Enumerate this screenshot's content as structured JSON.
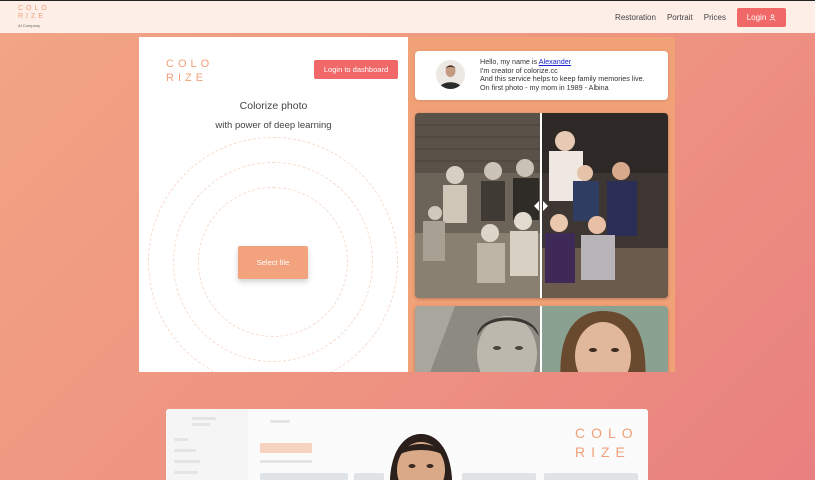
{
  "nav": {
    "logo_line1": "COLO",
    "logo_line2": "RIZE",
    "logo_sub": "AI Company",
    "links": [
      "Restoration",
      "Portrait",
      "Prices"
    ],
    "login_label": "Login"
  },
  "hero": {
    "logo_line1": "COLO",
    "logo_line2": "RIZE",
    "dashboard_button": "Login to dashboard",
    "tagline_1": "Colorize photo",
    "tagline_2": "with power of deep learning",
    "select_button": "Select file"
  },
  "intro": {
    "greeting": "Hello, my name is ",
    "name_link": "Alexander",
    "line2": "I'm creator of colorize.cc",
    "line3": "And this service helps to keep family memories live.",
    "line4": "On first photo - my mom in 1989 -  Albina"
  },
  "preview": {
    "logo_line1": "COLO",
    "logo_line2": "RIZE"
  },
  "colors": {
    "accent": "#f06868",
    "brand_orange": "#f0a07a",
    "select_button": "#f2a27c",
    "panel_orange": "#f1a176"
  },
  "icons": {
    "login": "user-icon",
    "compare_handle": "left-right-arrows-icon"
  }
}
